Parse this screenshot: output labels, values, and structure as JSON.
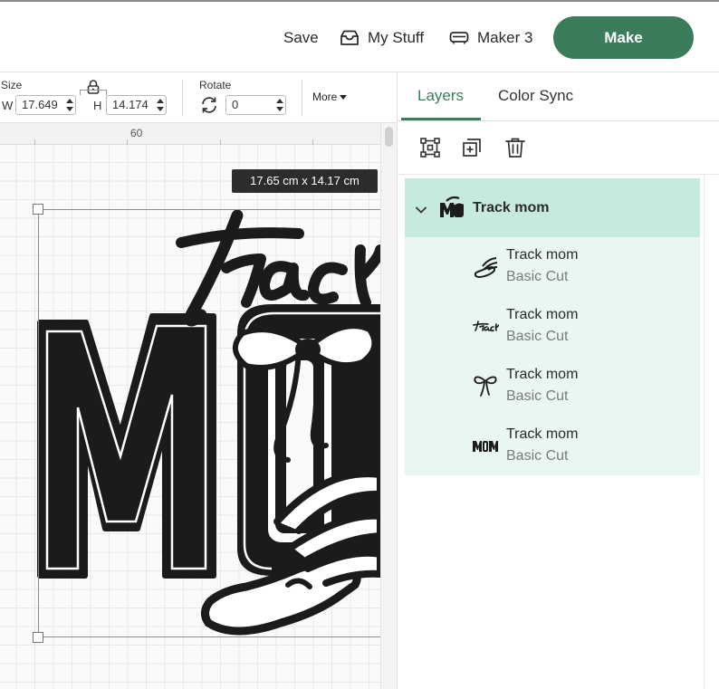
{
  "header": {
    "save_label": "Save",
    "my_stuff_label": "My Stuff",
    "machine_label": "Maker 3",
    "make_label": "Make",
    "accent_color": "#3b7d5b"
  },
  "toolbar": {
    "size_label": "Size",
    "width_prefix": "W",
    "width_value": "17.649",
    "height_prefix": "H",
    "height_value": "14.174",
    "rotate_label": "Rotate",
    "rotate_value": "0",
    "more_label": "More"
  },
  "canvas": {
    "ruler_mark": "60",
    "size_tooltip": "17.65  cm x 14.17  cm",
    "artwork_script_text": "track",
    "artwork_block_text": "MOM"
  },
  "panel": {
    "tabs": [
      {
        "label": "Layers",
        "active": true
      },
      {
        "label": "Color Sync",
        "active": false
      }
    ],
    "icons": [
      "group-icon",
      "duplicate-icon",
      "delete-icon"
    ],
    "group": {
      "title": "Track mom",
      "expanded": true
    },
    "layers": [
      {
        "name": "Track mom",
        "operation": "Basic Cut",
        "thumb": "winged-shoe"
      },
      {
        "name": "Track mom",
        "operation": "Basic Cut",
        "thumb": "track-script"
      },
      {
        "name": "Track mom",
        "operation": "Basic Cut",
        "thumb": "bow"
      },
      {
        "name": "Track mom",
        "operation": "Basic Cut",
        "thumb": "mom-block"
      }
    ]
  }
}
